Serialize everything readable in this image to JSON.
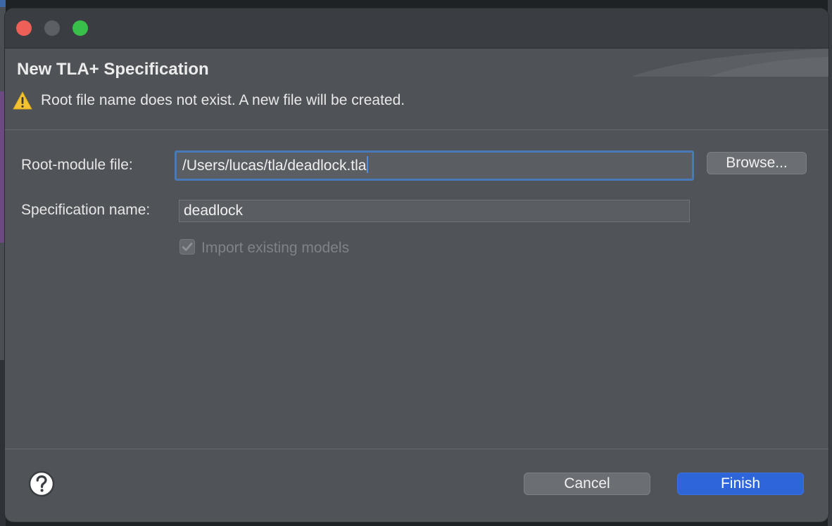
{
  "dialog": {
    "title": "New TLA+ Specification",
    "warning": "Root file name does not exist. A new file will be created."
  },
  "form": {
    "root_module_label": "Root-module file:",
    "root_module_value": "/Users/lucas/tla/deadlock.tla",
    "browse_label": "Browse...",
    "spec_name_label": "Specification name:",
    "spec_name_value": "deadlock",
    "import_models_label": "Import existing models",
    "import_models_checked": true
  },
  "footer": {
    "cancel_label": "Cancel",
    "finish_label": "Finish",
    "help_icon": "question-mark-icon"
  },
  "colors": {
    "accent": "#2e65d8",
    "focus_ring": "#4a79b8",
    "warning": "#f2c230"
  }
}
